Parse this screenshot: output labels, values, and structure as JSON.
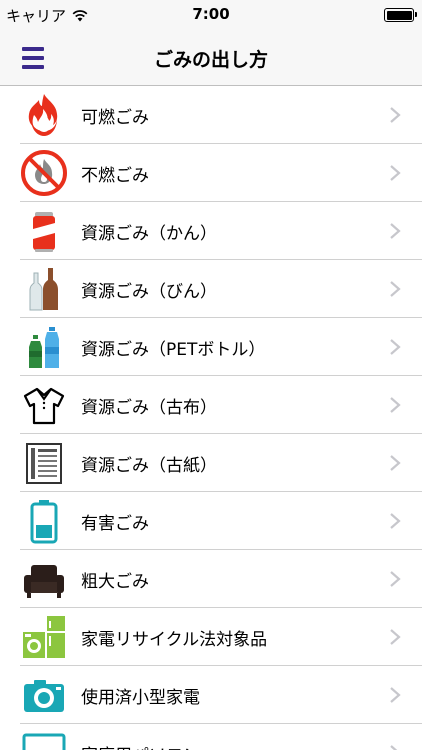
{
  "status_bar": {
    "carrier": "キャリア",
    "time": "7:00",
    "battery": 1.0
  },
  "nav": {
    "title": "ごみの出し方",
    "menu_icon": "hamburger-icon"
  },
  "colors": {
    "accent": "#3b2a8c",
    "chevron": "#c7c7cc",
    "separator": "#d0d0d0",
    "navbar_bg": "#f7f7f7"
  },
  "items": [
    {
      "label": "可燃ごみ",
      "icon": "flame-icon"
    },
    {
      "label": "不燃ごみ",
      "icon": "no-burn-icon"
    },
    {
      "label": "資源ごみ（かん）",
      "icon": "can-icon"
    },
    {
      "label": "資源ごみ（びん）",
      "icon": "bottles-icon"
    },
    {
      "label": "資源ごみ（PETボトル）",
      "icon": "pet-bottles-icon"
    },
    {
      "label": "資源ごみ（古布）",
      "icon": "shirt-icon"
    },
    {
      "label": "資源ごみ（古紙）",
      "icon": "newspaper-icon"
    },
    {
      "label": "有害ごみ",
      "icon": "battery-icon"
    },
    {
      "label": "粗大ごみ",
      "icon": "sofa-icon"
    },
    {
      "label": "家電リサイクル法対象品",
      "icon": "appliances-icon"
    },
    {
      "label": "使用済小型家電",
      "icon": "camera-icon"
    },
    {
      "label": "家庭用パソコン",
      "icon": "computer-icon"
    }
  ]
}
